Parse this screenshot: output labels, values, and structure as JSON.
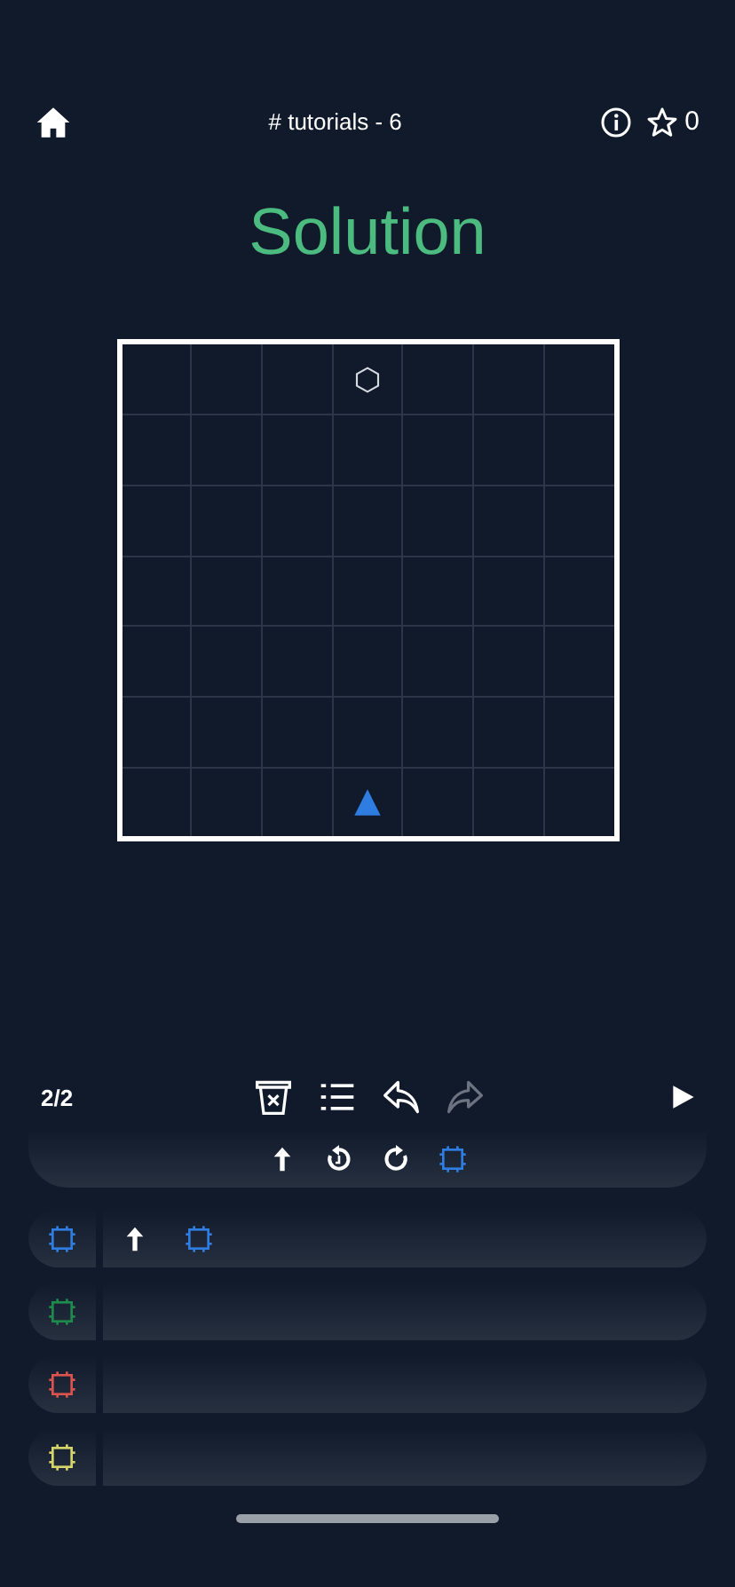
{
  "header": {
    "title": "# tutorials - 6",
    "star_count": "0"
  },
  "heading": "Solution",
  "board": {
    "rows": [
      {
        "cells": [
          {
            "kind": "empty"
          },
          {
            "kind": "empty"
          },
          {
            "kind": "empty"
          },
          {
            "kind": "goal"
          },
          {
            "kind": "empty"
          },
          {
            "kind": "empty"
          },
          {
            "kind": "empty"
          }
        ]
      },
      {
        "cells": [
          {
            "kind": "empty"
          },
          {
            "kind": "empty"
          },
          {
            "kind": "empty"
          },
          {
            "kind": "empty"
          },
          {
            "kind": "empty"
          },
          {
            "kind": "empty"
          },
          {
            "kind": "empty"
          }
        ]
      },
      {
        "cells": [
          {
            "kind": "empty"
          },
          {
            "kind": "empty"
          },
          {
            "kind": "empty"
          },
          {
            "kind": "empty"
          },
          {
            "kind": "empty"
          },
          {
            "kind": "empty"
          },
          {
            "kind": "empty"
          }
        ]
      },
      {
        "cells": [
          {
            "kind": "empty"
          },
          {
            "kind": "empty"
          },
          {
            "kind": "empty"
          },
          {
            "kind": "empty"
          },
          {
            "kind": "empty"
          },
          {
            "kind": "empty"
          },
          {
            "kind": "empty"
          }
        ]
      },
      {
        "cells": [
          {
            "kind": "empty"
          },
          {
            "kind": "empty"
          },
          {
            "kind": "empty"
          },
          {
            "kind": "empty"
          },
          {
            "kind": "empty"
          },
          {
            "kind": "empty"
          },
          {
            "kind": "empty"
          }
        ]
      },
      {
        "cells": [
          {
            "kind": "empty"
          },
          {
            "kind": "empty"
          },
          {
            "kind": "empty"
          },
          {
            "kind": "empty"
          },
          {
            "kind": "empty"
          },
          {
            "kind": "empty"
          },
          {
            "kind": "empty"
          }
        ]
      },
      {
        "cells": [
          {
            "kind": "empty"
          },
          {
            "kind": "empty"
          },
          {
            "kind": "empty"
          },
          {
            "kind": "player"
          },
          {
            "kind": "empty"
          },
          {
            "kind": "empty"
          },
          {
            "kind": "empty"
          }
        ]
      }
    ]
  },
  "toolbar": {
    "counter": "2/2",
    "tools": [
      {
        "kind": "clear",
        "disabled": false
      },
      {
        "kind": "list",
        "disabled": false
      },
      {
        "kind": "undo",
        "disabled": false
      },
      {
        "kind": "redo",
        "disabled": true
      }
    ]
  },
  "palette": [
    {
      "kind": "forward"
    },
    {
      "kind": "rotate-left"
    },
    {
      "kind": "rotate-right"
    },
    {
      "kind": "call",
      "color": "#2f7de1"
    }
  ],
  "functions": [
    {
      "color": "#2f7de1",
      "commands": [
        {
          "kind": "forward"
        },
        {
          "kind": "call",
          "color": "#2f7de1"
        }
      ]
    },
    {
      "color": "#1e8a4c"
    },
    {
      "color": "#d9534f"
    },
    {
      "color": "#d4d46a"
    }
  ]
}
